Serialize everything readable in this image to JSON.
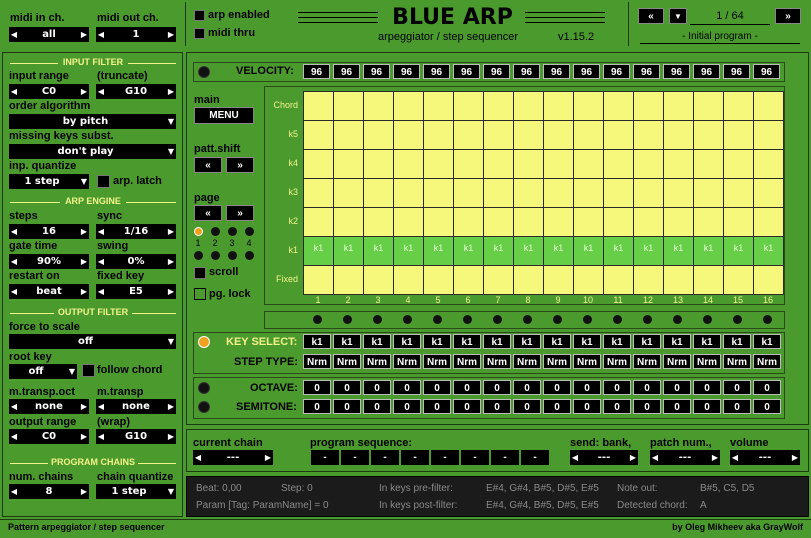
{
  "header": {
    "midi_in_label": "midi in ch.",
    "midi_in_value": "all",
    "midi_out_label": "midi out ch.",
    "midi_out_value": "1",
    "arp_enabled": "arp enabled",
    "midi_thru": "midi thru",
    "title": "BLUE ARP",
    "subtitle": "arpeggiator / step sequencer",
    "version": "v1.15.2",
    "program_counter": "1 / 64",
    "program_name": "- Initial program -"
  },
  "input_filter": {
    "title": "INPUT FILTER",
    "input_range_label": "input range",
    "truncate_label": "(truncate)",
    "range_low": "C0",
    "range_high": "G10",
    "order_label": "order algorithm",
    "order_value": "by pitch",
    "missing_label": "missing keys subst.",
    "missing_value": "don't play",
    "quantize_label": "inp. quantize",
    "quantize_value": "1 step",
    "arp_latch": "arp. latch"
  },
  "arp_engine": {
    "title": "ARP ENGINE",
    "steps_label": "steps",
    "steps_value": "16",
    "sync_label": "sync",
    "sync_value": "1/16",
    "gate_label": "gate time",
    "gate_value": "90%",
    "swing_label": "swing",
    "swing_value": "0%",
    "restart_label": "restart on",
    "restart_value": "beat",
    "fixed_label": "fixed key",
    "fixed_value": "E5"
  },
  "output_filter": {
    "title": "OUTPUT FILTER",
    "force_label": "force to scale",
    "force_value": "off",
    "root_label": "root key",
    "root_value": "off",
    "follow_chord": "follow chord",
    "transp_oct_label": "m.transp.oct",
    "transp_oct_value": "none",
    "transp_label": "m.transp",
    "transp_value": "none",
    "out_range_label": "output range",
    "wrap_label": "(wrap)",
    "out_low": "C0",
    "out_high": "G10"
  },
  "program_chains": {
    "title": "PROGRAM CHAINS",
    "num_label": "num. chains",
    "num_value": "8",
    "quant_label": "chain quantize",
    "quant_value": "1 step"
  },
  "sequencer": {
    "velocity_label": "VELOCITY:",
    "velocities": [
      "96",
      "96",
      "96",
      "96",
      "96",
      "96",
      "96",
      "96",
      "96",
      "96",
      "96",
      "96",
      "96",
      "96",
      "96",
      "96"
    ],
    "main_label": "main",
    "menu_button": "MENU",
    "patt_label": "patt.shift",
    "page_label": "page",
    "page_nums": [
      "1",
      "2",
      "3",
      "4"
    ],
    "scroll": "scroll",
    "pg_lock": "pg. lock",
    "row_labels": [
      "Chord",
      "k5",
      "k4",
      "k3",
      "k2",
      "k1",
      "Fixed"
    ],
    "active_label": "k1",
    "step_nums": [
      "1",
      "2",
      "3",
      "4",
      "5",
      "6",
      "7",
      "8",
      "9",
      "10",
      "11",
      "12",
      "13",
      "14",
      "15",
      "16"
    ],
    "key_select_label": "KEY SELECT:",
    "key_select": [
      "k1",
      "k1",
      "k1",
      "k1",
      "k1",
      "k1",
      "k1",
      "k1",
      "k1",
      "k1",
      "k1",
      "k1",
      "k1",
      "k1",
      "k1",
      "k1"
    ],
    "step_type_label": "STEP TYPE:",
    "step_types": [
      "Nrm",
      "Nrm",
      "Nrm",
      "Nrm",
      "Nrm",
      "Nrm",
      "Nrm",
      "Nrm",
      "Nrm",
      "Nrm",
      "Nrm",
      "Nrm",
      "Nrm",
      "Nrm",
      "Nrm",
      "Nrm"
    ],
    "octave_label": "OCTAVE:",
    "octaves": [
      "0",
      "0",
      "0",
      "0",
      "0",
      "0",
      "0",
      "0",
      "0",
      "0",
      "0",
      "0",
      "0",
      "0",
      "0",
      "0"
    ],
    "semitone_label": "SEMITONE:",
    "semitones": [
      "0",
      "0",
      "0",
      "0",
      "0",
      "0",
      "0",
      "0",
      "0",
      "0",
      "0",
      "0",
      "0",
      "0",
      "0",
      "0"
    ]
  },
  "chain": {
    "current_label": "current chain",
    "current_value": "---",
    "progseq_label": "program sequence:",
    "progseq": [
      "-",
      "-",
      "-",
      "-",
      "-",
      "-",
      "-",
      "-"
    ],
    "send_label": "send: bank,",
    "send_value": "---",
    "pnum_label": "patch num.,",
    "pnum_value": "---",
    "volume_label": "volume",
    "volume_value": "---"
  },
  "status": {
    "beat": "Beat: 0,00",
    "step": "Step: 0",
    "param": "Param [Tag: ParamName] = 0",
    "pre_filter_label": "In keys pre-filter:",
    "pre_filter_value": "E#4, G#4, B#5, D#5, E#5",
    "post_filter_label": "In keys post-filter:",
    "post_filter_value": "E#4, G#4, B#5, D#5, E#5",
    "note_out_label": "Note out:",
    "note_out_value": "B#5, C5, D5",
    "chord_label": "Detected chord:",
    "chord_value": "A"
  },
  "footer": {
    "left": "Pattern arpeggiator / step sequencer",
    "right": "by Oleg Mikheev aka GrayWolf"
  },
  "colors": {
    "background": "#4b9a2e",
    "grid_cell": "#f6f87c",
    "active_cell": "#67cf47",
    "accent_text": "#f3f38a"
  }
}
